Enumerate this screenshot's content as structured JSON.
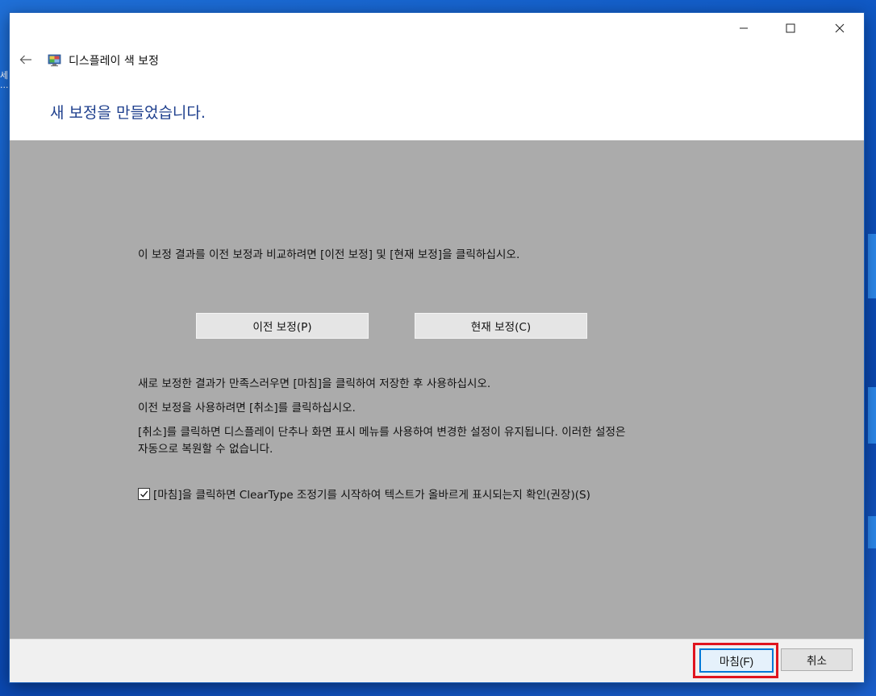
{
  "desktop": {
    "left_fragment": "세\n..."
  },
  "window": {
    "app_title": "디스플레이 색 보정",
    "heading": "새 보정을 만들었습니다.",
    "caption": {
      "minimize_icon": "minimize-icon",
      "maximize_icon": "maximize-icon",
      "close_icon": "close-icon"
    },
    "nav": {
      "back_icon": "back-arrow-icon",
      "app_icon": "display-color-calibration-icon"
    }
  },
  "content": {
    "compare_text": "이 보정 결과를 이전 보정과 비교하려면 [이전 보정] 및 [현재 보정]을 클릭하십시오.",
    "buttons": {
      "previous": "이전 보정(P)",
      "current": "현재 보정(C)"
    },
    "save_text": "새로 보정한 결과가 만족스러우면 [마침]을 클릭하여 저장한 후 사용하십시오.",
    "use_prev_text": "이전 보정을 사용하려면 [취소]를 클릭하십시오.",
    "cancel_note_line1": "[취소]를 클릭하면 디스플레이 단추나 화면 표시 메뉴를 사용하여 변경한 설정이 유지됩니다. 이러한 설정은",
    "cancel_note_line2": "자동으로 복원할 수 없습니다.",
    "cleartype_checkbox": {
      "label": "[마침]을 클릭하면 ClearType 조정기를 시작하여 텍스트가 올바르게 표시되는지 확인(권장)(S)",
      "checked": true
    }
  },
  "footer": {
    "finish": "마침(F)",
    "cancel": "취소",
    "highlight_color": "#e0141e"
  },
  "colors": {
    "heading": "#1e3f8d",
    "content_bg": "#ababab",
    "accent": "#0078d7",
    "desktop": "#0e56c2"
  }
}
